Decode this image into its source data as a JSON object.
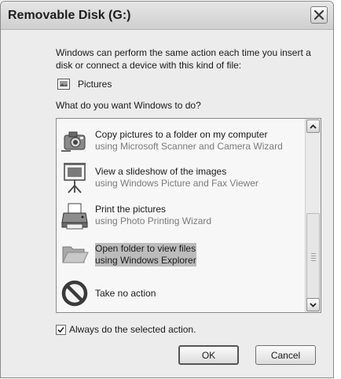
{
  "window": {
    "title": "Removable Disk (G:)",
    "close_glyph": "×"
  },
  "intro_text": "Windows can perform the same action each time you insert a disk or connect a device with this kind of file:",
  "media": {
    "icon": "pictures-file-icon",
    "label": "Pictures"
  },
  "question": "What do you want Windows to do?",
  "actions": [
    {
      "icon": "camera-icon",
      "title": "Copy pictures to a folder on my computer",
      "subtitle": "using Microsoft Scanner and Camera Wizard"
    },
    {
      "icon": "slideshow-projector-icon",
      "title": "View a slideshow of the images",
      "subtitle": "using Windows Picture and Fax Viewer"
    },
    {
      "icon": "printer-icon",
      "title": "Print the pictures",
      "subtitle": "using Photo Printing Wizard"
    },
    {
      "icon": "open-folder-icon",
      "title": "Open folder to view files",
      "subtitle": "using Windows Explorer",
      "selected": true
    },
    {
      "icon": "no-action-icon",
      "title": "Take no action"
    }
  ],
  "always_checkbox": {
    "label": "Always do the selected action.",
    "checked": true
  },
  "buttons": {
    "ok": "OK",
    "cancel": "Cancel"
  }
}
